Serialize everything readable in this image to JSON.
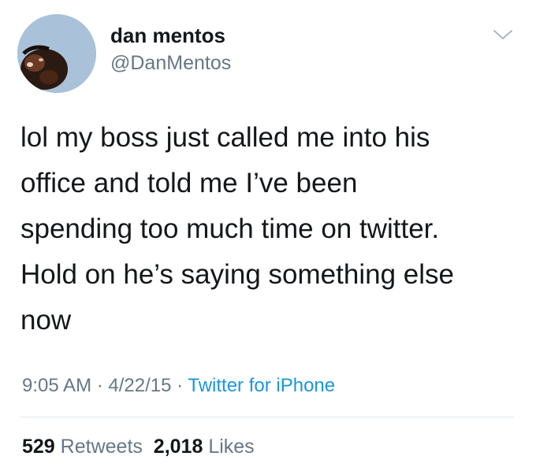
{
  "tweet": {
    "author": {
      "name": "dan mentos",
      "handle": "@DanMentos"
    },
    "text": "lol my boss just called me into his\noffice and told me I’ve been\nspending too much time on twitter.\nHold on he’s saying something else\nnow",
    "time": "9:05 AM",
    "separator": " · ",
    "date": "4/22/15",
    "source": "Twitter for iPhone",
    "stats": {
      "retweets_count": "529",
      "retweets_label": "Retweets",
      "likes_count": "2,018",
      "likes_label": "Likes"
    }
  },
  "icons": {
    "menu": "chevron-down-icon"
  },
  "colors": {
    "text": "#14171a",
    "secondary": "#657786",
    "link": "#1b95e0",
    "divider": "#e1e8ed"
  }
}
